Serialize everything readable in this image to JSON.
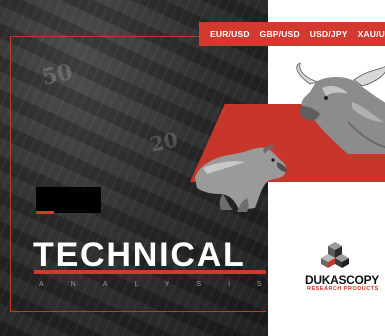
{
  "colors": {
    "accent": "#d23a2f",
    "dark_bg": "#2a2a2a",
    "white": "#ffffff"
  },
  "currency_tabs": [
    "EUR/USD",
    "GBP/USD",
    "USD/JPY",
    "XAU/U"
  ],
  "banner": {
    "title": "TECHNICAL",
    "subtitle": "ANALYSIS"
  },
  "money_background": {
    "printed_numbers": [
      "50",
      "20"
    ]
  },
  "logo": {
    "name": "DUKASCOPY",
    "tagline": "RESEARCH PRODUCTS"
  },
  "illustrations": {
    "left": "bear-figure",
    "right": "bull-figure"
  }
}
